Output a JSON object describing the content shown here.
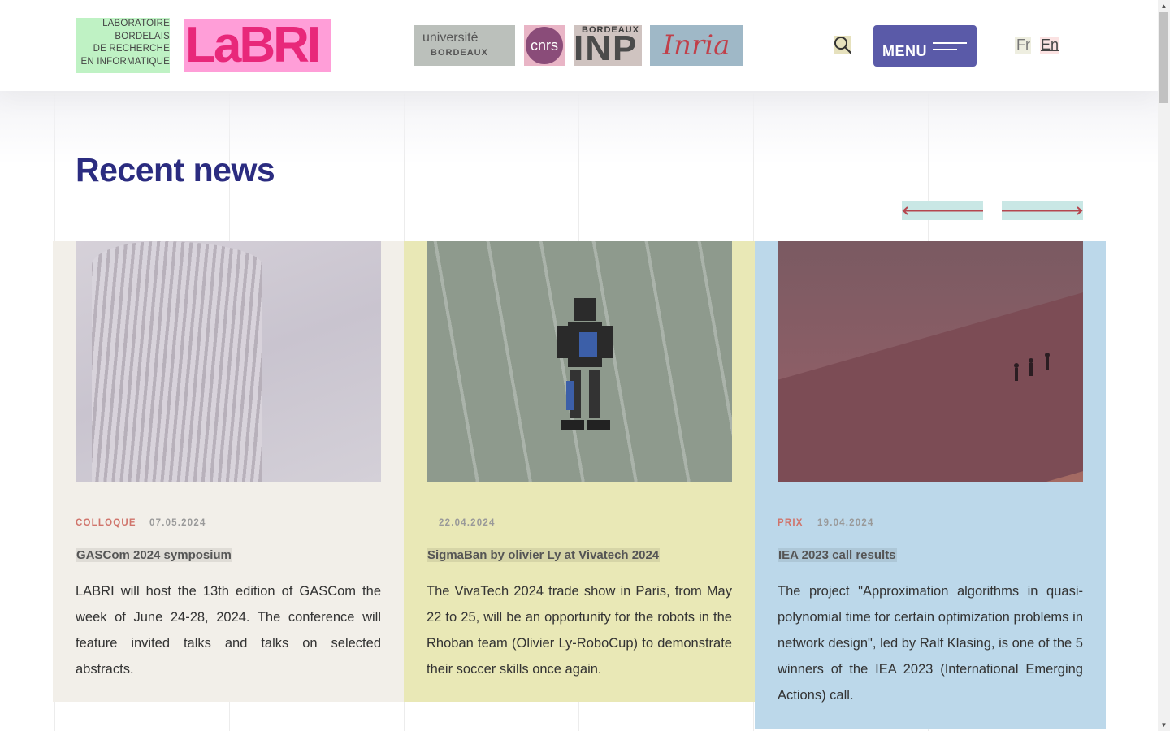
{
  "header": {
    "lab_name_lines": [
      "LABORATOIRE",
      "BORDELAIS",
      "DE RECHERCHE",
      "EN INFORMATIQUE"
    ],
    "logo_text": "LaBRI",
    "partners": {
      "ubx_line1": "université",
      "ubx_line2": "BORDEAUX",
      "cnrs": "cnrs",
      "inp_top": "BORDEAUX",
      "inp_big": "INP",
      "inria": "Inria"
    },
    "menu_label": "MENU",
    "lang_fr": "Fr",
    "lang_en": "En"
  },
  "section": {
    "title": "Recent news"
  },
  "news": [
    {
      "category": "COLLOQUE",
      "date": "07.05.2024",
      "title": "GASCom 2024 symposium",
      "text": "LABRI will host the 13th edition of GASCom the week of June 24-28, 2024. The conference will feature invited talks and talks on selected abstracts."
    },
    {
      "category": "",
      "date": "22.04.2024",
      "title": "SigmaBan by olivier Ly at Vivatech 2024",
      "text": "The VivaTech 2024 trade show in Paris, from May 22 to 25, will be an opportunity for the robots in the Rhoban team (Olivier Ly-RoboCup) to demonstrate their soccer skills once again."
    },
    {
      "category": "PRIX",
      "date": "19.04.2024",
      "title": "IEA 2023 call results",
      "text": "The project \"Approximation algorithms in quasi-polynomial time for certain optimization problems in network design\", led by Ralf Klasing, is one of the 5 winners of the IEA 2023 (International Emerging Actions) call."
    }
  ],
  "colors": {
    "brand_pink": "#e8287a",
    "title_navy": "#2b2c80",
    "menu_purple": "#5a5aa8",
    "arrow_red": "#b5474f"
  }
}
